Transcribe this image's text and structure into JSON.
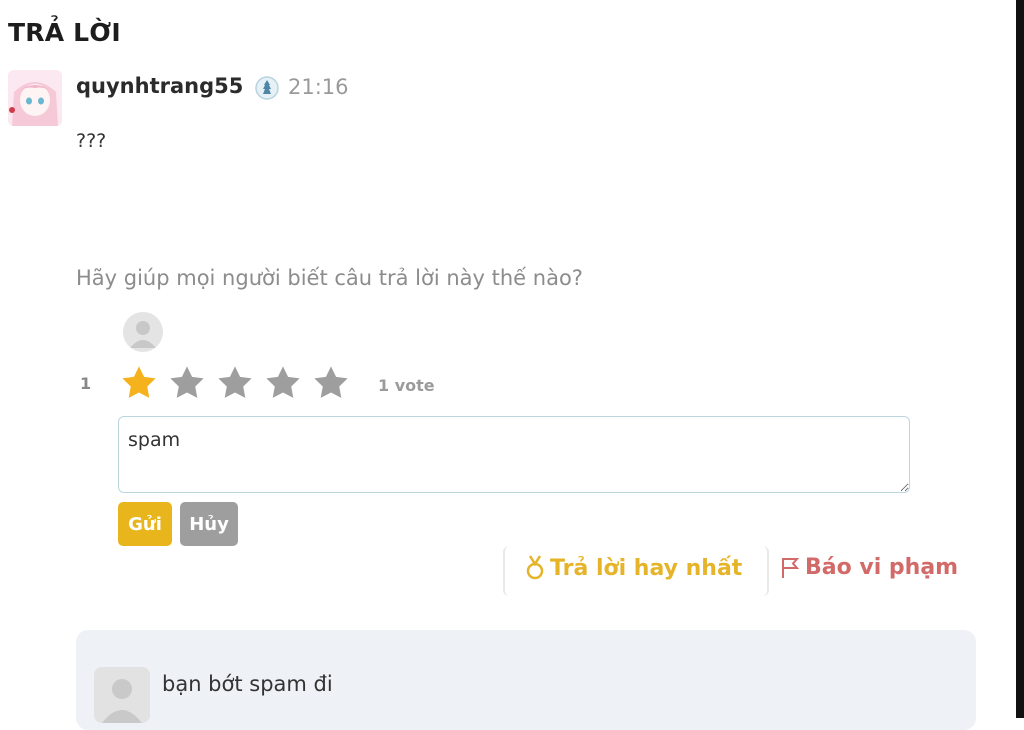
{
  "section": {
    "title": "TRẢ LỜI"
  },
  "answer": {
    "username": "quynhtrang55",
    "time": "21:16",
    "text": "???",
    "badge_icon": "rank-badge-icon",
    "avatar_icon": "anime-avatar"
  },
  "rating": {
    "prompt": "Hãy giúp mọi người biết câu trả lời này thế nào?",
    "user_rating": "1",
    "stars_filled": 1,
    "stars_total": 5,
    "vote_count": "1 vote",
    "star_colors": {
      "filled": "#f5b21c",
      "empty": "#9e9e9e"
    }
  },
  "comment_form": {
    "value": "spam",
    "send_label": "Gửi",
    "cancel_label": "Hủy"
  },
  "actions": {
    "best_answer_label": "Trả lời hay nhất",
    "report_label": "Báo vi phạm",
    "best_answer_icon": "medal-icon",
    "report_icon": "flag-icon"
  },
  "comments": [
    {
      "text": "bạn bớt spam đi"
    }
  ]
}
